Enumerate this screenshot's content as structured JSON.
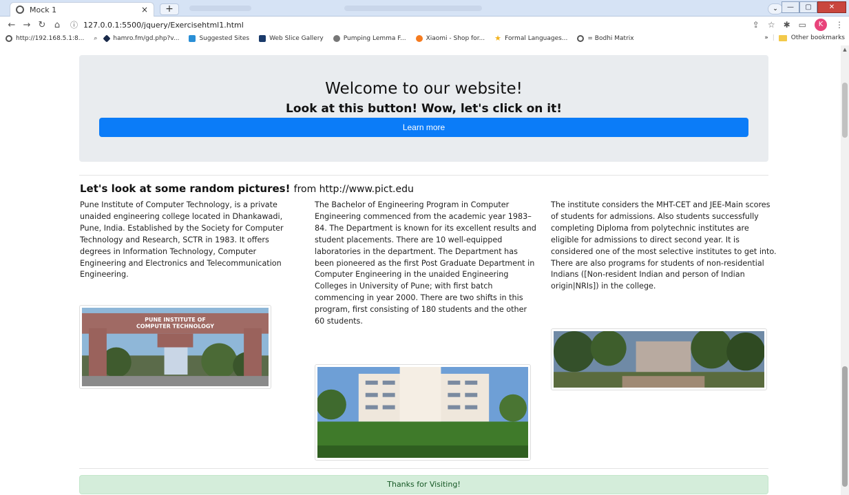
{
  "browser": {
    "tab_title": "Mock 1",
    "tab_close": "×",
    "new_tab": "+",
    "url": "127.0.0.1:5500/jquery/Exercisehtml1.html",
    "profile_initial": "K",
    "bookmarks": [
      {
        "label": "http://192.168.5.1:8...",
        "color": "#333333"
      },
      {
        "label": "hamro.fm/gd.php?v...",
        "color": "#1a2a4a"
      },
      {
        "label": "Suggested Sites",
        "color": "#2a8fd6"
      },
      {
        "label": "Web Slice Gallery",
        "color": "#1a3a6a"
      },
      {
        "label": "Pumping Lemma F...",
        "color": "#555555"
      },
      {
        "label": "Xiaomi - Shop for...",
        "color": "#f57b1f"
      },
      {
        "label": "Formal Languages...",
        "color": "#f2b21b"
      },
      {
        "label": "= Bodhi Matrix",
        "color": "#333333"
      }
    ],
    "overflow": "»",
    "other_bookmarks": "Other bookmarks"
  },
  "jumbotron": {
    "title": "Welcome to our website!",
    "subtitle": "Look at this button! Wow, let's click on it!",
    "button_label": "Learn more"
  },
  "section": {
    "title": "Let's look at some random pictures!",
    "from": "from http://www.pict.edu"
  },
  "columns": [
    "Pune Institute of Computer Technology, is a private unaided engineering college located in Dhankawadi, Pune, India. Established by the Society for Computer Technology and Research, SCTR in 1983. It offers degrees in Information Technology, Computer Engineering and Electronics and Telecommunication Engineering.",
    "The Bachelor of Engineering Program in Computer Engineering commenced from the academic year 1983–84. The Department is known for its excellent results and student placements. There are 10 well-equipped laboratories in the department. The Department has been pioneered as the first Post Graduate Department in Computer Engineering in the unaided Engineering Colleges in University of Pune; with first batch commencing in year 2000. There are two shifts in this program, first consisting of 180 students and the other 60 students.",
    "The institute considers the MHT-CET and JEE-Main scores of students for admissions. Also students successfully completing Diploma from polytechnic institutes are eligible for admissions to direct second year. It is considered one of the most selective institutes to get into. There are also programs for students of non-residential Indians ([Non-resident Indian and person of Indian origin|NRIs]) in the college."
  ],
  "images": {
    "gate_sign_line1": "PUNE INSTITUTE OF",
    "gate_sign_line2": "COMPUTER TECHNOLOGY"
  },
  "footer": {
    "text": "Thanks for Visiting!"
  }
}
